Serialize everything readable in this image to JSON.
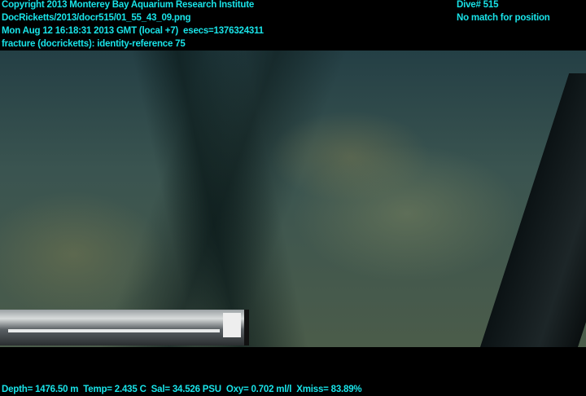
{
  "header_left": {
    "copyright": "Copyright 2013 Monterey Bay Aquarium Research Institute",
    "file_path": "DocRicketts/2013/docr515/01_55_43_09.png",
    "timestamp": "Mon Aug 12 16:18:31 2013 GMT (local +7)  esecs=1376324311",
    "annotation": "fracture (docricketts): identity-reference 75"
  },
  "header_right": {
    "dive": "Dive# 515",
    "position": "No match for position"
  },
  "footer": {
    "telemetry": "Depth= 1476.50 m  Temp= 2.435 C  Sal= 34.526 PSU  Oxy= 0.702 ml/l  Xmiss= 83.89%"
  },
  "colors": {
    "overlay_text": "#19e3e8"
  }
}
